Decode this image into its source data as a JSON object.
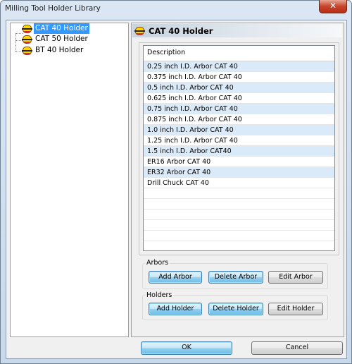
{
  "window": {
    "title": "Milling Tool Holder Library",
    "close_label": "✕"
  },
  "tree": {
    "items": [
      {
        "label": "CAT 40 Holder",
        "selected": true
      },
      {
        "label": "CAT 50 Holder"
      },
      {
        "label": "BT 40 Holder"
      }
    ]
  },
  "panel": {
    "title": "CAT 40 Holder",
    "list": {
      "column": "Description",
      "rows": [
        "0.25 inch I.D. Arbor CAT 40",
        "0.375 inch I.D. Arbor CAT 40",
        "0.5 inch I.D. Arbor CAT 40",
        "0.625 inch I.D. Arbor CAT 40",
        "0.75 inch I.D. Arbor CAT 40",
        "0.875 inch I.D. Arbor CAT 40",
        "1.0 inch I.D. Arbor CAT 40",
        "1.25 inch I.D. Arbor CAT 40",
        "1.5 inch I.D. Arbor CAT40",
        "ER16 Arbor CAT 40",
        "ER32 Arbor CAT 40",
        "Drill Chuck CAT 40"
      ]
    },
    "arbors": {
      "label": "Arbors",
      "add": "Add Arbor",
      "delete": "Delete Arbor",
      "edit": "Edit Arbor"
    },
    "holders": {
      "label": "Holders",
      "add": "Add Holder",
      "delete": "Delete Holder",
      "edit": "Edit Holder"
    }
  },
  "footer": {
    "ok": "OK",
    "cancel": "Cancel"
  },
  "colors": {
    "selection": "#3399ff",
    "row_alt": "#dbeaf9",
    "close": "#c7442b"
  }
}
